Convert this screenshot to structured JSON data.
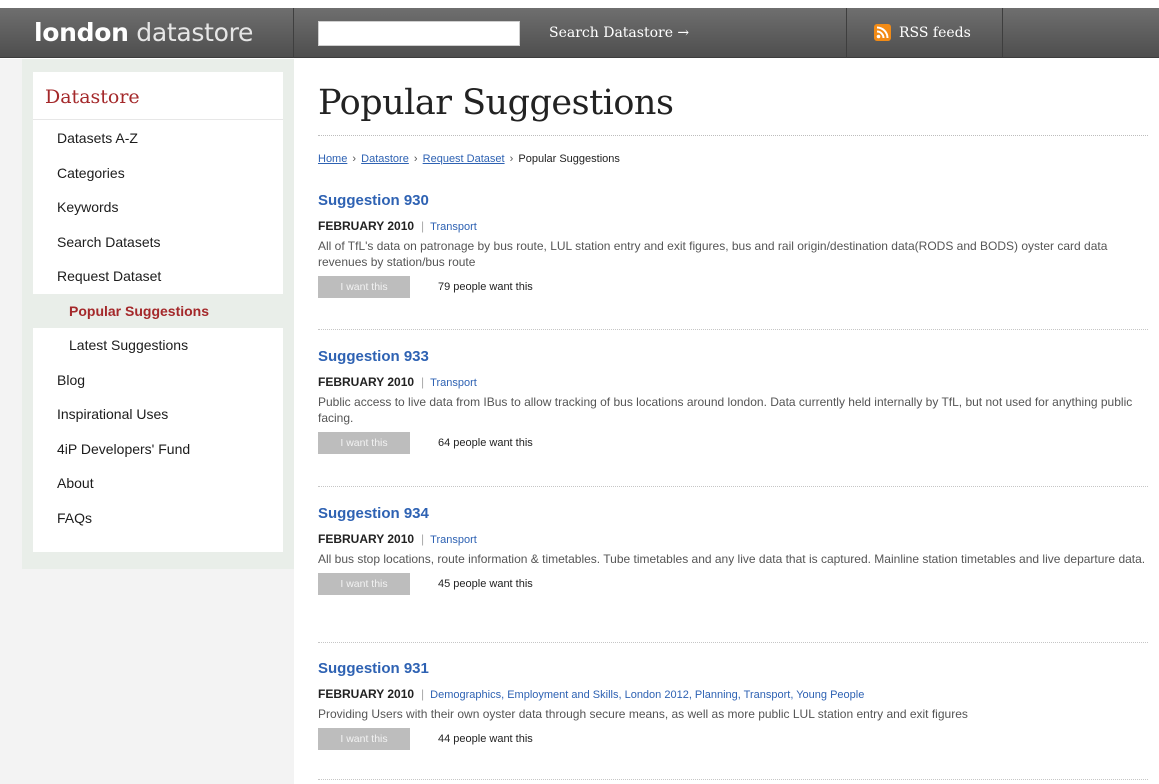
{
  "header": {
    "brand_bold": "london",
    "brand_light": "datastore",
    "search_placeholder": "",
    "search_button": "Search Datastore →",
    "rss_label": "RSS feeds"
  },
  "sidebar": {
    "title": "Datastore",
    "items": [
      {
        "label": "Datasets A-Z"
      },
      {
        "label": "Categories"
      },
      {
        "label": "Keywords"
      },
      {
        "label": "Search Datasets"
      },
      {
        "label": "Request Dataset"
      },
      {
        "label": "Popular Suggestions"
      },
      {
        "label": "Latest Suggestions"
      },
      {
        "label": "Blog"
      },
      {
        "label": "Inspirational Uses"
      },
      {
        "label": "4iP Developers' Fund"
      },
      {
        "label": "About"
      },
      {
        "label": "FAQs"
      }
    ]
  },
  "main": {
    "title": "Popular Suggestions",
    "breadcrumb": {
      "home": "Home",
      "datastore": "Datastore",
      "request": "Request Dataset",
      "current": "Popular Suggestions",
      "sep": "›"
    },
    "want_button": "I want this",
    "suggestions": [
      {
        "title": "Suggestion 930",
        "date": "FEBRUARY 2010",
        "pipe": "|",
        "categories": "Transport",
        "description": "All of TfL's data on patronage by bus route, LUL station entry and exit figures, bus and rail origin/destination data(RODS and BODS) oyster card data revenues by station/bus route",
        "count": "79 people want this"
      },
      {
        "title": "Suggestion 933",
        "date": "FEBRUARY 2010",
        "pipe": "|",
        "categories": "Transport",
        "description": "Public access to live data from IBus to allow tracking of bus locations around london. Data currently held internally by TfL, but not used for anything public facing.",
        "count": "64 people want this"
      },
      {
        "title": "Suggestion 934",
        "date": "FEBRUARY 2010",
        "pipe": "|",
        "categories": "Transport",
        "description": "All bus stop locations, route information & timetables. Tube timetables and any live data that is captured. Mainline station timetables and live departure data.",
        "count": "45 people want this"
      },
      {
        "title": "Suggestion 931",
        "date": "FEBRUARY 2010",
        "pipe": "|",
        "categories": "Demographics, Employment and Skills, London 2012, Planning, Transport, Young People",
        "description": "Providing Users with their own oyster data through secure means, as well as more public LUL station entry and exit figures",
        "count": "44 people want this"
      }
    ]
  },
  "colors": {
    "accent_red": "#a4282a",
    "link_blue": "#2e62b3",
    "header_gray": "#5a5a5a",
    "rss_orange": "#f28b16"
  },
  "icons": {
    "search_arrow": "arrow-right-icon",
    "rss": "rss-icon"
  }
}
